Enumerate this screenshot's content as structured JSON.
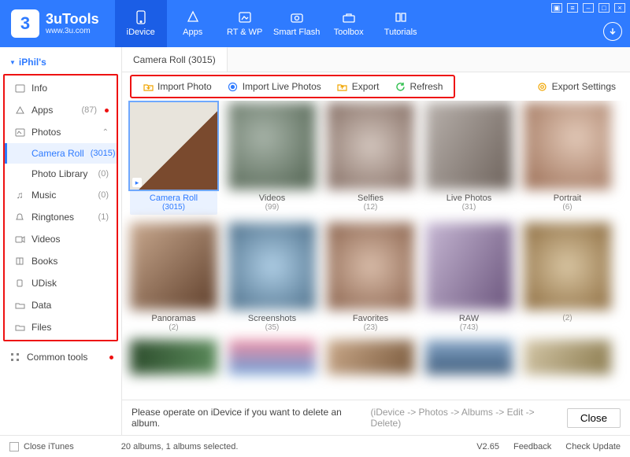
{
  "brand": {
    "title": "3uTools",
    "url": "www.3u.com"
  },
  "nav": [
    {
      "label": "iDevice"
    },
    {
      "label": "Apps"
    },
    {
      "label": "RT & WP"
    },
    {
      "label": "Smart Flash"
    },
    {
      "label": "Toolbox"
    },
    {
      "label": "Tutorials"
    }
  ],
  "sidebar": {
    "device": "iPhil's",
    "items": [
      {
        "name": "info",
        "label": "Info"
      },
      {
        "name": "apps",
        "label": "Apps",
        "count": "(87)",
        "dot": true
      },
      {
        "name": "photos",
        "label": "Photos",
        "expandable": true
      },
      {
        "name": "music",
        "label": "Music",
        "count": "(0)"
      },
      {
        "name": "ringtones",
        "label": "Ringtones",
        "count": "(1)"
      },
      {
        "name": "videos",
        "label": "Videos"
      },
      {
        "name": "books",
        "label": "Books"
      },
      {
        "name": "udisk",
        "label": "UDisk"
      },
      {
        "name": "data",
        "label": "Data"
      },
      {
        "name": "files",
        "label": "Files"
      }
    ],
    "photos_children": [
      {
        "label": "Camera Roll",
        "count": "(3015)",
        "sel": true
      },
      {
        "label": "Photo Library",
        "count": "(0)"
      }
    ],
    "common_tools": "Common tools"
  },
  "tab": {
    "label": "Camera Roll (3015)"
  },
  "toolbar": {
    "import": "Import Photo",
    "importLive": "Import Live Photos",
    "export": "Export",
    "refresh": "Refresh",
    "exportSettings": "Export Settings"
  },
  "albums": {
    "row1": [
      {
        "name": "Camera Roll",
        "count": "(3015)",
        "cls": "t-cam",
        "sel": true,
        "vid": true
      },
      {
        "name": "Videos",
        "count": "(99)",
        "cls": "t-a"
      },
      {
        "name": "Selfies",
        "count": "(12)",
        "cls": "t-b"
      },
      {
        "name": "Live Photos",
        "count": "(31)",
        "cls": "t-c"
      },
      {
        "name": "Portrait",
        "count": "(6)",
        "cls": "t-d"
      }
    ],
    "row2": [
      {
        "name": "Panoramas",
        "count": "(2)",
        "cls": "t-e"
      },
      {
        "name": "Screenshots",
        "count": "(35)",
        "cls": "t-f"
      },
      {
        "name": "Favorites",
        "count": "(23)",
        "cls": "t-g"
      },
      {
        "name": "RAW",
        "count": "(743)",
        "cls": "t-h"
      },
      {
        "name": "",
        "count": "(2)",
        "cls": "t-i"
      }
    ],
    "row3": [
      {
        "cls": "t-j"
      },
      {
        "cls": "t-k"
      },
      {
        "cls": "t-l"
      },
      {
        "cls": "t-m"
      },
      {
        "cls": "t-n"
      }
    ]
  },
  "msg": {
    "text": "Please operate on iDevice if you want to delete an album.",
    "hint": "(iDevice -> Photos -> Albums -> Edit -> Delete)",
    "close": "Close"
  },
  "footer": {
    "closeItunes": "Close iTunes",
    "status": "20 albums, 1 albums selected.",
    "version": "V2.65",
    "feedback": "Feedback",
    "update": "Check Update"
  }
}
